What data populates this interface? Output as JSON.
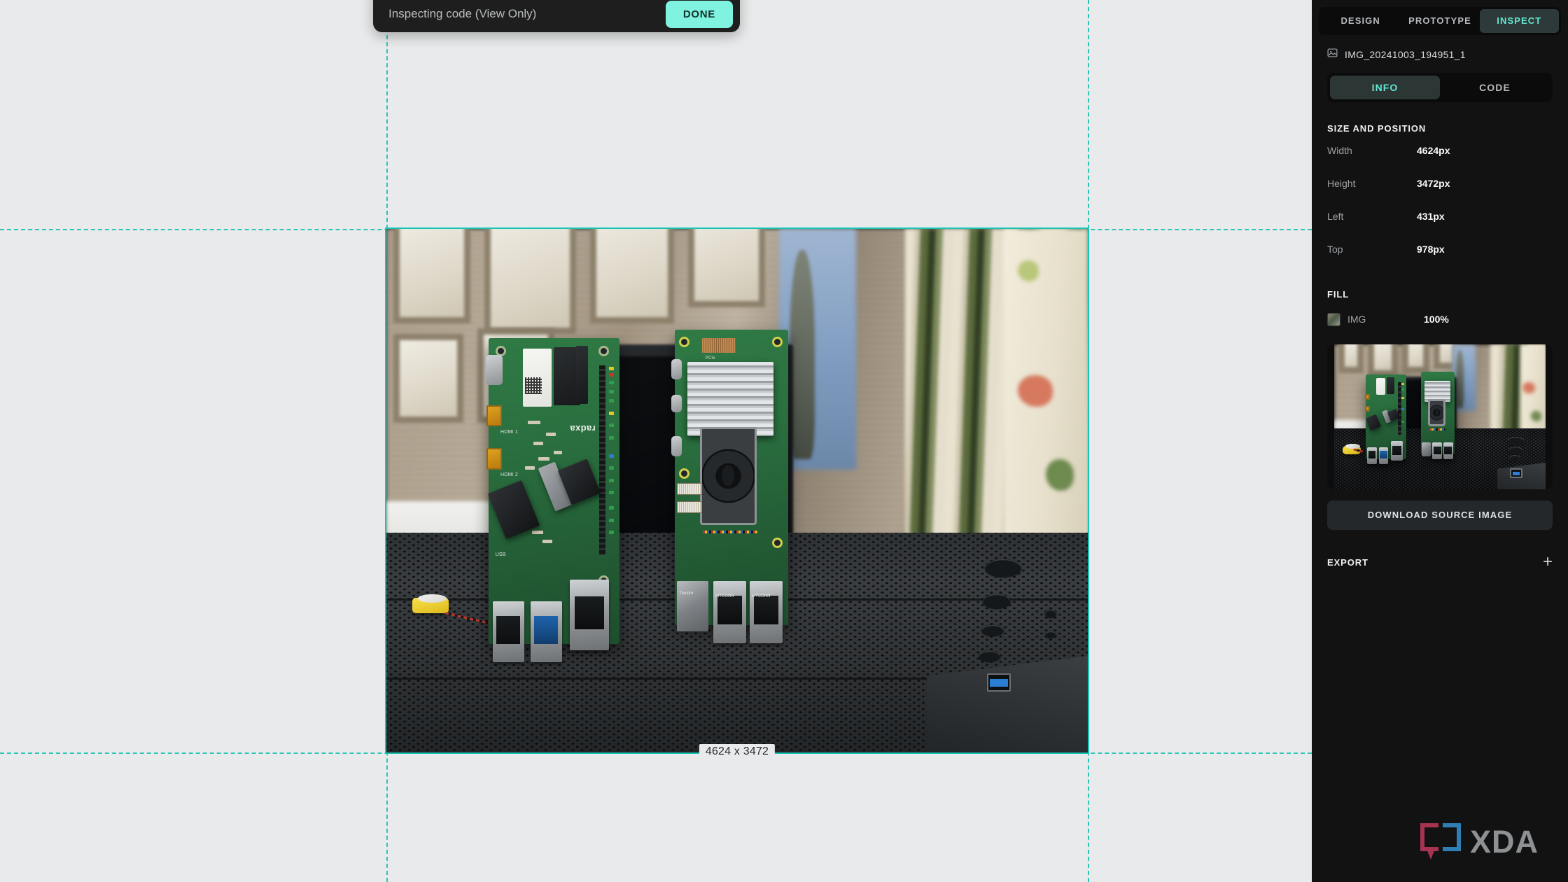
{
  "toast": {
    "message": "Inspecting code (View Only)",
    "done_label": "DONE"
  },
  "panel": {
    "tabs": [
      {
        "label": "DESIGN",
        "active": false
      },
      {
        "label": "PROTOTYPE",
        "active": false
      },
      {
        "label": "INSPECT",
        "active": true
      }
    ],
    "layer": {
      "icon": "image-icon",
      "name": "IMG_20241003_194951_1"
    },
    "subtabs": [
      {
        "label": "INFO",
        "active": true
      },
      {
        "label": "CODE",
        "active": false
      }
    ],
    "size_and_position": {
      "title": "SIZE AND POSITION",
      "rows": [
        {
          "key": "Width",
          "value": "4624px"
        },
        {
          "key": "Height",
          "value": "3472px"
        },
        {
          "key": "Left",
          "value": "431px"
        },
        {
          "key": "Top",
          "value": "978px"
        }
      ]
    },
    "fill": {
      "title": "FILL",
      "name": "IMG",
      "opacity": "100%"
    },
    "download_label": "DOWNLOAD SOURCE IMAGE",
    "export": {
      "title": "EXPORT",
      "add_icon": "plus-icon"
    }
  },
  "canvas": {
    "selection_label": "4624 x 3472",
    "guides": {
      "vertical": [
        552,
        1554
      ],
      "horizontal": [
        327,
        1075
      ]
    }
  },
  "watermark": {
    "text": "XDA"
  },
  "colors": {
    "accent_teal": "#63e8d3",
    "toast_bg": "#1e1e1e",
    "done_button": "#7ff3e0",
    "panel_bg": "#121212",
    "canvas_bg": "#e8eaeb",
    "selection_outline": "#17c5b4",
    "xda_red": "#a63350",
    "xda_blue": "#2f7fb5",
    "xda_grey": "#8e9194"
  }
}
